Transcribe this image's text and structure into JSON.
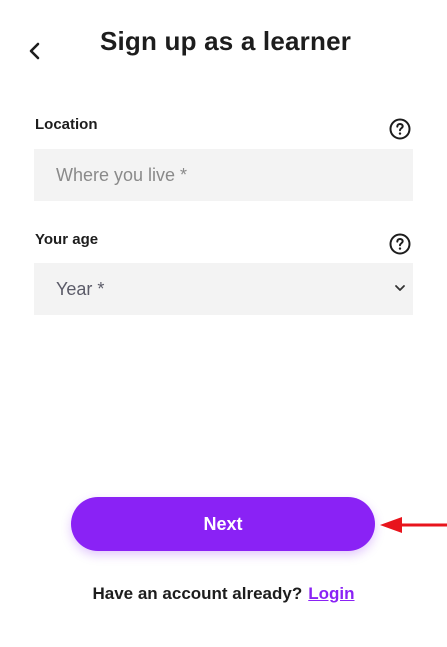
{
  "header": {
    "title": "Sign up as a learner"
  },
  "form": {
    "location": {
      "label": "Location",
      "placeholder": "Where you live *",
      "value": ""
    },
    "age": {
      "label": "Your age",
      "selected": "Year *"
    }
  },
  "actions": {
    "next_label": "Next"
  },
  "footer": {
    "prompt": "Have an account already?",
    "login_label": "Login"
  },
  "colors": {
    "accent": "#8a22f5",
    "input_bg": "#f3f3f3",
    "annotation_arrow": "#e8141c"
  },
  "icons": {
    "back": "chevron-left-icon",
    "help": "question-circle-icon",
    "select": "chevron-down-icon"
  }
}
